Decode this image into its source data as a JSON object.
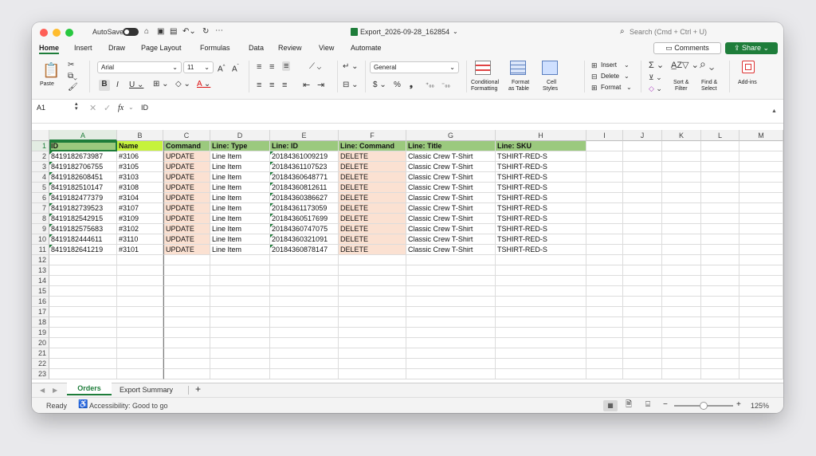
{
  "window": {
    "title": "Export_2026-09-28_162854",
    "autosave_label": "AutoSave",
    "search_placeholder": "Search (Cmd + Ctrl + U)"
  },
  "tabs": [
    "Home",
    "Insert",
    "Draw",
    "Page Layout",
    "Formulas",
    "Data",
    "Review",
    "View",
    "Automate"
  ],
  "buttons": {
    "comments": "Comments",
    "share": "Share"
  },
  "ribbon": {
    "paste": "Paste",
    "font_name": "Arial",
    "font_size": "11",
    "number_format": "General",
    "conditional_formatting": [
      "Conditional",
      "Formatting"
    ],
    "format_as_table": [
      "Format",
      "as Table"
    ],
    "cell_styles": [
      "Cell",
      "Styles"
    ],
    "insert": "Insert",
    "delete": "Delete",
    "format": "Format",
    "sort_filter": [
      "Sort &",
      "Filter"
    ],
    "find_select": [
      "Find &",
      "Select"
    ],
    "add_ins": "Add-ins"
  },
  "formula_bar": {
    "name_box": "A1",
    "fx": "fx",
    "value": "ID"
  },
  "columns": [
    "A",
    "B",
    "C",
    "D",
    "E",
    "F",
    "G",
    "H",
    "I",
    "J",
    "K",
    "L",
    "M"
  ],
  "row_numbers": [
    "1",
    "2",
    "3",
    "4",
    "5",
    "6",
    "7",
    "8",
    "9",
    "10",
    "11",
    "12",
    "13",
    "14",
    "15",
    "16",
    "17",
    "18",
    "19",
    "20",
    "21",
    "22",
    "23"
  ],
  "headers": [
    "ID",
    "Name",
    "Command",
    "Line: Type",
    "Line: ID",
    "Line: Command",
    "Line: Title",
    "Line: SKU"
  ],
  "rows": [
    [
      "8419182673987",
      "#3106",
      "UPDATE",
      "Line Item",
      "20184361009219",
      "DELETE",
      "Classic Crew T-Shirt",
      "TSHIRT-RED-S"
    ],
    [
      "8419182706755",
      "#3105",
      "UPDATE",
      "Line Item",
      "20184361107523",
      "DELETE",
      "Classic Crew T-Shirt",
      "TSHIRT-RED-S"
    ],
    [
      "8419182608451",
      "#3103",
      "UPDATE",
      "Line Item",
      "20184360648771",
      "DELETE",
      "Classic Crew T-Shirt",
      "TSHIRT-RED-S"
    ],
    [
      "8419182510147",
      "#3108",
      "UPDATE",
      "Line Item",
      "20184360812611",
      "DELETE",
      "Classic Crew T-Shirt",
      "TSHIRT-RED-S"
    ],
    [
      "8419182477379",
      "#3104",
      "UPDATE",
      "Line Item",
      "20184360386627",
      "DELETE",
      "Classic Crew T-Shirt",
      "TSHIRT-RED-S"
    ],
    [
      "8419182739523",
      "#3107",
      "UPDATE",
      "Line Item",
      "20184361173059",
      "DELETE",
      "Classic Crew T-Shirt",
      "TSHIRT-RED-S"
    ],
    [
      "8419182542915",
      "#3109",
      "UPDATE",
      "Line Item",
      "20184360517699",
      "DELETE",
      "Classic Crew T-Shirt",
      "TSHIRT-RED-S"
    ],
    [
      "8419182575683",
      "#3102",
      "UPDATE",
      "Line Item",
      "20184360747075",
      "DELETE",
      "Classic Crew T-Shirt",
      "TSHIRT-RED-S"
    ],
    [
      "8419182444611",
      "#3110",
      "UPDATE",
      "Line Item",
      "20184360321091",
      "DELETE",
      "Classic Crew T-Shirt",
      "TSHIRT-RED-S"
    ],
    [
      "8419182641219",
      "#3101",
      "UPDATE",
      "Line Item",
      "20184360878147",
      "DELETE",
      "Classic Crew T-Shirt",
      "TSHIRT-RED-S"
    ]
  ],
  "colors": {
    "header_green": "#9bc97e",
    "header_lime": "#c6f23c",
    "peach": "#fbe1d2",
    "accent": "#1e7d3a"
  },
  "sheets": [
    "Orders",
    "Export Summary"
  ],
  "status": {
    "ready": "Ready",
    "accessibility": "Accessibility: Good to go",
    "zoom": "125%"
  }
}
